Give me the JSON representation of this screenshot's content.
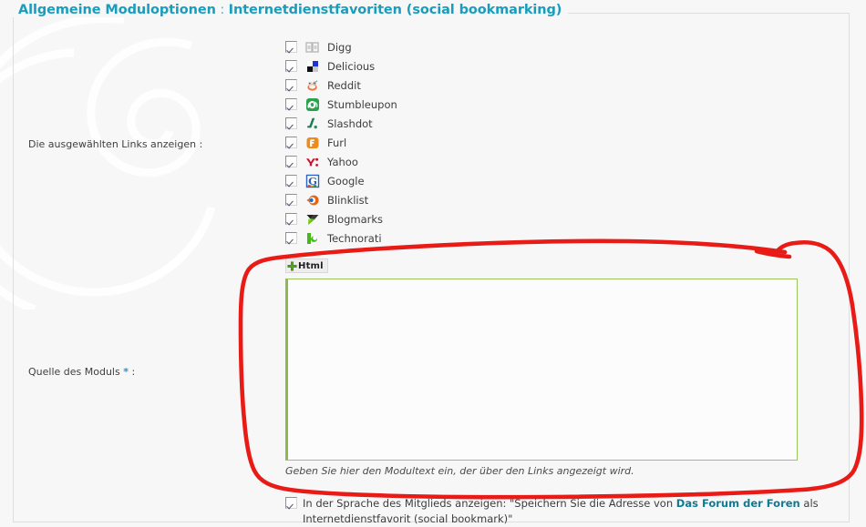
{
  "panel": {
    "legend_main": "Allgemeine Moduloptionen",
    "legend_separator": " : ",
    "legend_sub": "Internetdienstfavoriten (social bookmarking)",
    "legend_accent_color": "#1a9dbd",
    "border_color": "#dedede",
    "background_color": "#f7f7f7"
  },
  "links_field": {
    "label": "Die ausgewählten Links anzeigen :",
    "services": [
      {
        "name": "Digg",
        "icon": "digg-icon",
        "checked": true
      },
      {
        "name": "Delicious",
        "icon": "delicious-icon",
        "checked": true
      },
      {
        "name": "Reddit",
        "icon": "reddit-icon",
        "checked": true
      },
      {
        "name": "Stumbleupon",
        "icon": "stumbleupon-icon",
        "checked": true
      },
      {
        "name": "Slashdot",
        "icon": "slashdot-icon",
        "checked": true
      },
      {
        "name": "Furl",
        "icon": "furl-icon",
        "checked": true
      },
      {
        "name": "Yahoo",
        "icon": "yahoo-icon",
        "checked": true
      },
      {
        "name": "Google",
        "icon": "google-icon",
        "checked": true
      },
      {
        "name": "Blinklist",
        "icon": "blinklist-icon",
        "checked": true
      },
      {
        "name": "Blogmarks",
        "icon": "blogmarks-icon",
        "checked": true
      },
      {
        "name": "Technorati",
        "icon": "technorati-icon",
        "checked": true
      }
    ]
  },
  "source_field": {
    "label_text": "Quelle des Moduls",
    "required_marker": "*",
    "label_colon": ":",
    "html_button_label": "Html",
    "html_button_icon": "green-plus-icon",
    "textarea_value": "",
    "textarea_placeholder": "",
    "textarea_border_color": "#9cc45e",
    "help_text": "Geben Sie hier den Modultext ein, der über den Links angezeigt wird."
  },
  "member_language": {
    "checked": true,
    "text_part1": "In der Sprache des Mitglieds anzeigen: \"Speichern Sie die Adresse von ",
    "site_name": "Das Forum der Foren",
    "text_part2": " als Internetdienstfavorit (social bookmark)\""
  },
  "annotation": {
    "shape": "hand-drawn-red-rounded-rectangle",
    "color": "#e81b17"
  }
}
